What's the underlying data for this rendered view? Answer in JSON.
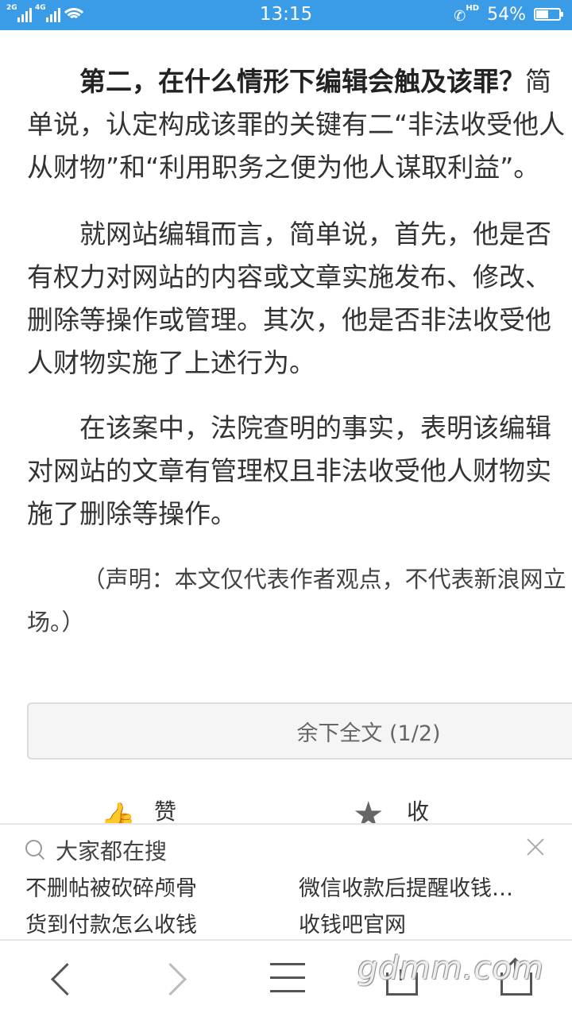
{
  "status_bar": {
    "sim1": "2G",
    "sim2": "4G",
    "time": "13:15",
    "hd": "HD",
    "battery_text": "54%",
    "battery_level": 0.54
  },
  "article": {
    "lead_strong": "第二，在什么情形下编辑会触及该罪？",
    "lead_rest": "简单说，认定构成该罪的关键有二“非法收受他人从财物”和“利用职务之便为他人谋取利益”。",
    "p2": "就网站编辑而言，简单说，首先，他是否有权力对网站的内容或文章实施发布、修改、删除等操作或管理。其次，他是否非法收受他人财物实施了上述行为。",
    "p3": "在该案中，法院查明的事实，表明该编辑对网站的文章有管理权且非法收受他人财物实施了删除等操作。",
    "notice": "（声明：本文仅代表作者观点，不代表新浪网立场。）"
  },
  "more_button": "余下全文 (1/2)",
  "actions": {
    "like": "赞",
    "favorite": "收藏"
  },
  "search_panel": {
    "title": "大家都在搜",
    "items": [
      "不删帖被砍碎颅骨",
      "微信收款后提醒收钱…",
      "货到付款怎么收钱",
      "收钱吧官网"
    ]
  },
  "watermark": "gdmm.com"
}
